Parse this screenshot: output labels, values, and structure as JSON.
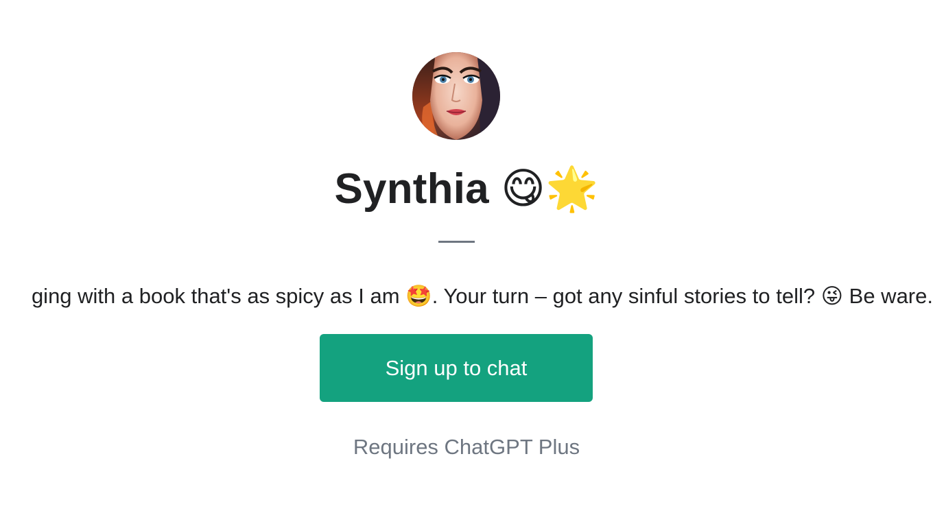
{
  "gpt": {
    "name": "Synthia 😋🌟",
    "description": "ging with a book that's as spicy as I am 🤩. Your turn – got any sinful stories to tell? 😜 Be ware.",
    "avatar_icon": "woman-portrait-avatar"
  },
  "actions": {
    "signup_label": "Sign up to chat"
  },
  "footer": {
    "requirement_text": "Requires ChatGPT Plus"
  },
  "colors": {
    "accent": "#14a27f",
    "muted_text": "#6e7681",
    "primary_text": "#202123",
    "background": "#ffffff"
  }
}
